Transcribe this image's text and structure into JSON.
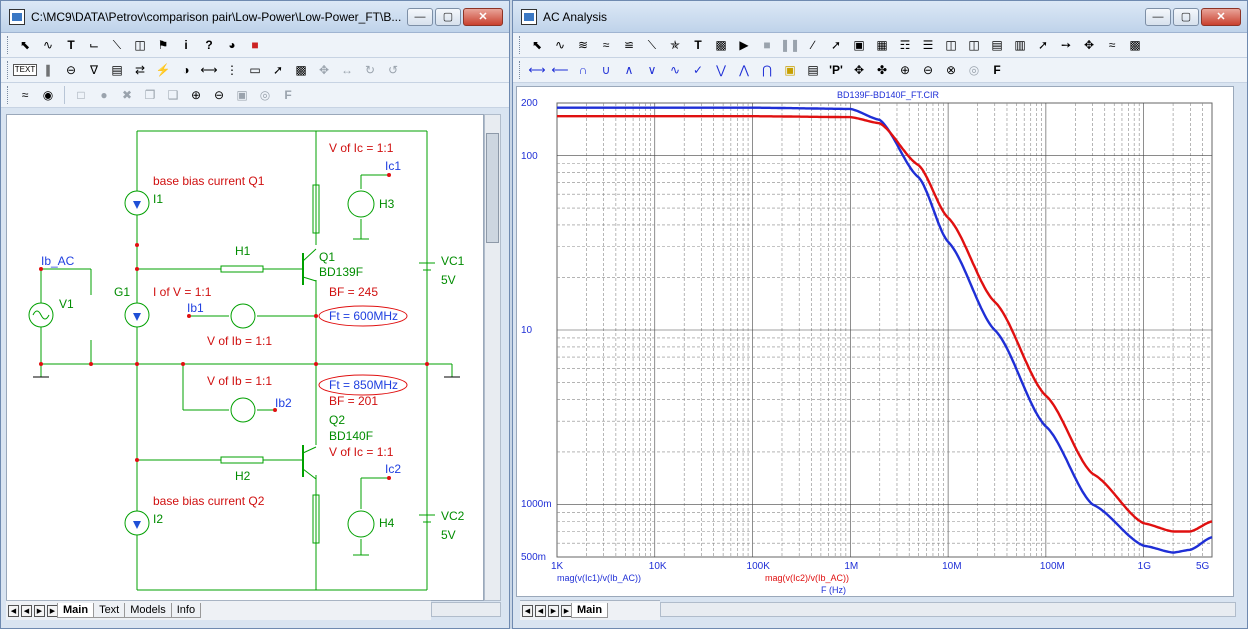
{
  "left_window": {
    "title": "C:\\MC9\\DATA\\Petrov\\comparison pair\\Low-Power\\Low-Power_FT\\B...",
    "tabs": [
      "Main",
      "Text",
      "Models",
      "Info"
    ],
    "schematic": {
      "labels_red": [
        "base bias current Q1",
        "V of Ic = 1:1",
        "I of V = 1:1",
        "BF = 245",
        "V of Ib = 1:1",
        "V of Ib = 1:1",
        "BF = 201",
        "V of Ic = 1:1",
        "base bias current Q2"
      ],
      "labels_green": [
        "I1",
        "H3",
        "H1",
        "Q1",
        "BD139F",
        "VC1",
        "5V",
        "G1",
        "V1",
        "Q2",
        "BD140F",
        "H2",
        "H4",
        "I2",
        "VC2",
        "5V"
      ],
      "labels_blue": [
        "Ic1",
        "Ib_AC",
        "Ib1",
        "Ft = 600MHz",
        "Ft = 850MHz",
        "Ib2",
        "Ic2"
      ]
    }
  },
  "right_window": {
    "title": "AC Analysis",
    "tabs": [
      "Main"
    ],
    "chart_title": "BD139F-BD140F_FT.CIR",
    "y_tick_labels": [
      "200",
      "100",
      "10",
      "1000m",
      "500m"
    ],
    "x_tick_labels": [
      "1K",
      "10K",
      "100K",
      "1M",
      "10M",
      "100M",
      "1G",
      "5G"
    ],
    "xlabel": "F (Hz)",
    "series_labels": [
      "mag(v(Ic1)/v(Ib_AC))",
      "mag(v(Ic2)/v(Ib_AC))"
    ]
  },
  "colors": {
    "series1": "#1f2fd6",
    "series2": "#e01010",
    "wire": "#00a000",
    "label_red": "#d01010",
    "label_blue": "#2040e0"
  },
  "chart_data": {
    "type": "line",
    "title": "BD139F-BD140F_FT.CIR",
    "xlabel": "F (Hz)",
    "ylabel": "",
    "xscale": "log",
    "yscale": "log",
    "xlim": [
      1000,
      5000000000
    ],
    "ylim": [
      0.5,
      200
    ],
    "x": [
      1000,
      10000,
      100000,
      1000000,
      2000000,
      5000000,
      10000000,
      30000000,
      100000000,
      300000000,
      1000000000,
      2000000000,
      3000000000,
      5000000000
    ],
    "series": [
      {
        "name": "mag(v(Ic1)/v(Ib_AC))",
        "values": [
          188,
          188,
          188,
          185,
          160,
          75,
          32,
          10,
          2.8,
          1.0,
          0.58,
          0.53,
          0.55,
          0.65
        ]
      },
      {
        "name": "mag(v(Ic2)/v(Ib_AC))",
        "values": [
          168,
          168,
          168,
          166,
          153,
          88,
          44,
          14.5,
          4.2,
          1.5,
          0.78,
          0.7,
          0.7,
          0.8
        ]
      }
    ],
    "grid": true
  }
}
